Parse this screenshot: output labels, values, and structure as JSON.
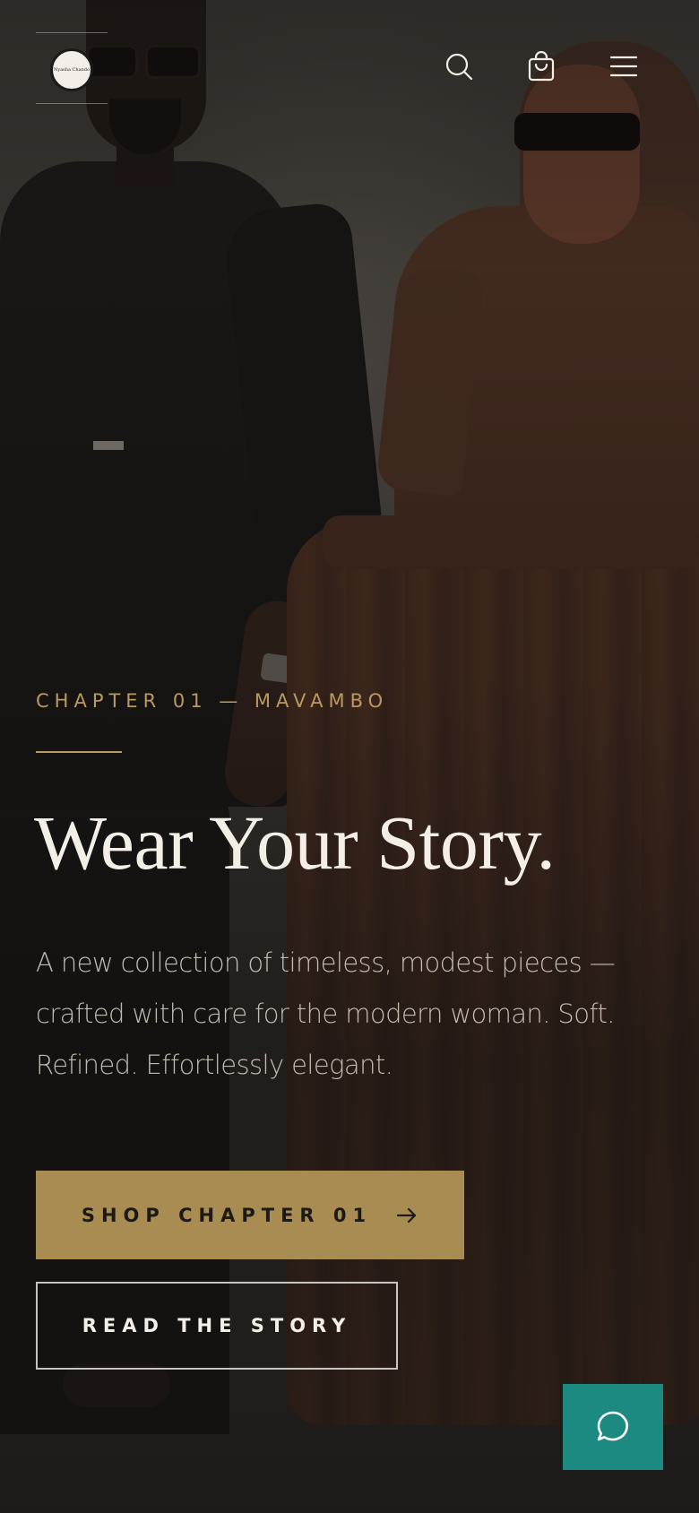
{
  "header": {
    "logo_text": "Nyasha Chando",
    "icons": {
      "search": "search-icon",
      "cart": "shopping-bag-icon",
      "menu": "hamburger-menu-icon"
    }
  },
  "hero": {
    "eyebrow": "CHAPTER 01 — MAVAMBO",
    "headline": "Wear Your Story.",
    "subcopy": "A new collection of timeless, modest pieces — crafted with care for the modern woman. Soft. Refined. Effortlessly elegant.",
    "primary_cta": "SHOP CHAPTER 01",
    "secondary_cta": "READ THE STORY"
  },
  "chat": {
    "icon": "chat-bubble-icon"
  },
  "colors": {
    "accent_gold": "#a98c52",
    "eyebrow_gold": "#b89a62",
    "chat_teal": "#1c8a80",
    "text_light": "#f4efe6"
  }
}
